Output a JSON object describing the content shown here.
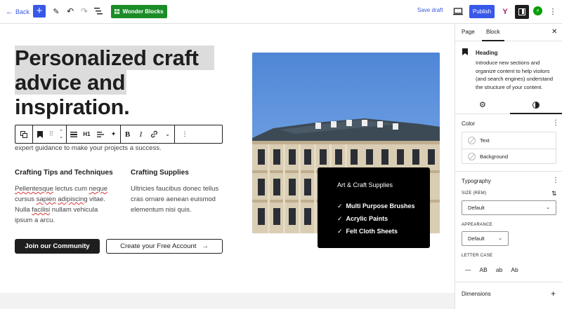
{
  "topbar": {
    "back_label": "Back",
    "add_symbol": "+",
    "wonder_label": "Wonder Blocks",
    "save_draft": "Save draft",
    "publish": "Publish",
    "yoast_label": "Y",
    "icons": [
      "pencil-icon",
      "undo-icon",
      "redo-icon",
      "list-view-icon",
      "preview-icon",
      "sidebar-toggle-icon",
      "jetpack-icon",
      "more-vertical-icon"
    ]
  },
  "canvas": {
    "heading": [
      "Personalized craft",
      "advice and",
      "inspiration."
    ],
    "intro": "expert guidance to make your projects a success.",
    "block_toolbar": {
      "heading_level": "H1",
      "bold": "B",
      "italic": "I"
    },
    "columns": [
      {
        "title": "Crafting Tips and Techniques",
        "text_parts": [
          {
            "t": "Pellentesque",
            "sq": true
          },
          {
            "t": " lectus cum ",
            "sq": false
          },
          {
            "t": "neque",
            "sq": true
          },
          {
            "t": " cursus ",
            "sq": false
          },
          {
            "t": "sapien",
            "sq": true
          },
          {
            "t": " ",
            "sq": false
          },
          {
            "t": "adipiscing",
            "sq": true
          },
          {
            "t": " vitae. Nulla ",
            "sq": false
          },
          {
            "t": "facilisi",
            "sq": true
          },
          {
            "t": " nullam vehicula ipsum a arcu.",
            "sq": false
          }
        ]
      },
      {
        "title": "Crafting Supplies",
        "text": "Ultricies faucibus donec tellus cras ornare aenean euismod elementum nisi quis."
      }
    ],
    "btn_primary": "Join our Community",
    "btn_secondary": "Create your Free Account",
    "btn_secondary_arrow": "→",
    "overlay": {
      "title": "Art & Craft Supplies",
      "items": [
        "Multi Purpose Brushes",
        "Acrylic Paints",
        "Felt Cloth Sheets"
      ],
      "check": "✓"
    },
    "colors": {
      "accent": "#3858e9",
      "wonder": "#1b8c27",
      "dark": "#1e1e1e"
    }
  },
  "sidebar": {
    "tab_page": "Page",
    "tab_block": "Block",
    "block_name": "Heading",
    "block_desc": "Introduce new sections and organize content to help visitors (and search engines) understand the structure of your content.",
    "color": {
      "title": "Color",
      "text": "Text",
      "background": "Background"
    },
    "typography": {
      "title": "Typography",
      "size_label": "SIZE (REM)",
      "size_value": "Default",
      "appearance_label": "APPEARANCE",
      "appearance_value": "Default",
      "letter_case_label": "LETTER CASE",
      "letter_case": [
        "—",
        "AB",
        "ab",
        "Ab"
      ]
    },
    "dimensions": "Dimensions"
  }
}
